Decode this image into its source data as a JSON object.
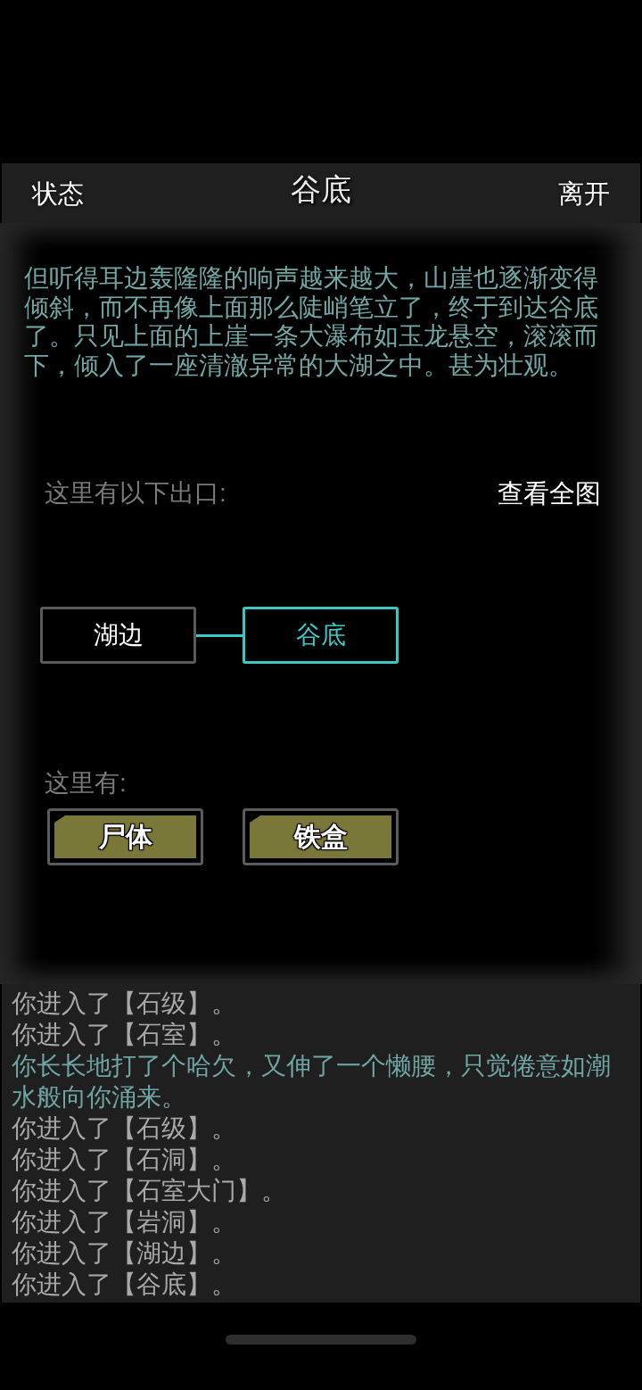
{
  "header": {
    "left_button": "状态",
    "title": "谷底",
    "right_button": "离开"
  },
  "description": "但听得耳边轰隆隆的响声越来越大，山崖也逐渐变得倾斜，而不再像上面那么陡峭笔立了，终于到达谷底了。只见上面的上崖一条大瀑布如玉龙悬空，滚滚而下，倾入了一座清澈异常的大湖之中。甚为壮观。",
  "exits": {
    "label": "这里有以下出口:",
    "map_button": "查看全图",
    "rooms": [
      {
        "name": "湖边",
        "current": false
      },
      {
        "name": "谷底",
        "current": true
      }
    ]
  },
  "items": {
    "label": "这里有:",
    "entries": [
      "尸体",
      "铁盒"
    ]
  },
  "log": [
    {
      "kind": "move",
      "text": "你进入了【石级】。"
    },
    {
      "kind": "move",
      "text": "你进入了【石室】。"
    },
    {
      "kind": "flavor",
      "text": "你长长地打了个哈欠，又伸了一个懒腰，只觉倦意如潮水般向你涌来。"
    },
    {
      "kind": "move",
      "text": "你进入了【石级】。"
    },
    {
      "kind": "move",
      "text": "你进入了【石洞】。"
    },
    {
      "kind": "move",
      "text": "你进入了【石室大门】。"
    },
    {
      "kind": "move",
      "text": "你进入了【岩洞】。"
    },
    {
      "kind": "move",
      "text": "你进入了【湖边】。"
    },
    {
      "kind": "move",
      "text": "你进入了【谷底】。"
    }
  ]
}
